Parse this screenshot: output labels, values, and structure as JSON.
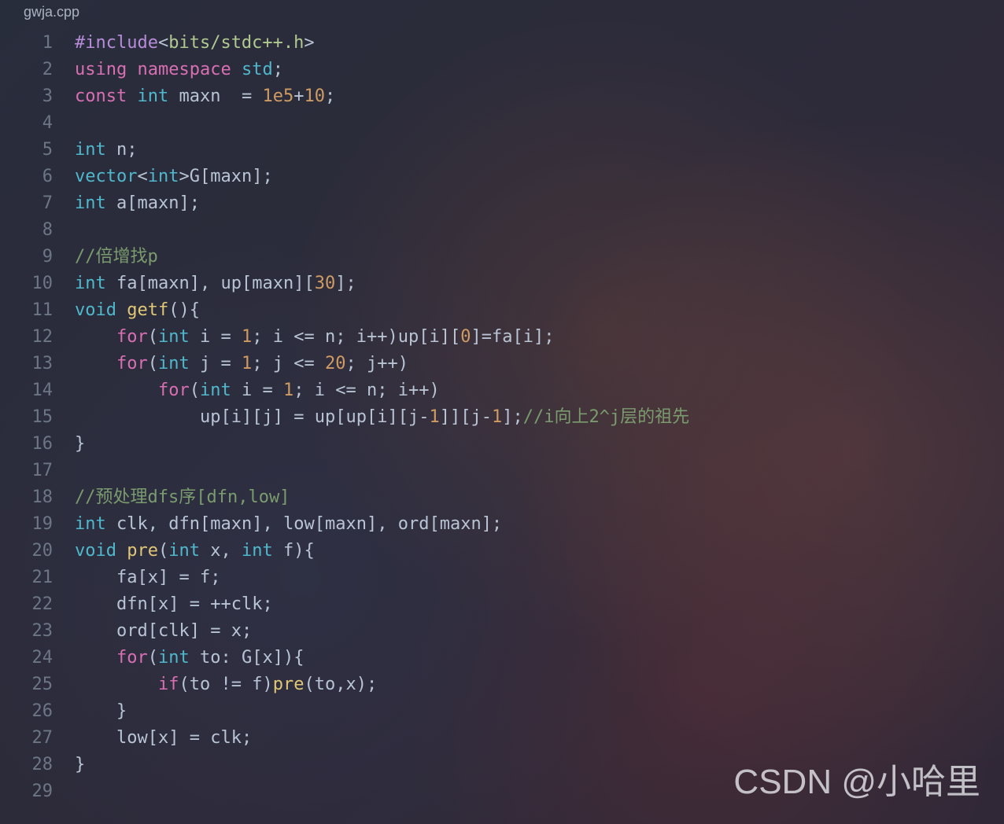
{
  "tab": {
    "filename": "gwja.cpp"
  },
  "watermark": "CSDN @小哈里",
  "lines": [
    {
      "n": 1,
      "tokens": [
        [
          "preproc",
          "#include"
        ],
        [
          "punct",
          "<"
        ],
        [
          "string",
          "bits/stdc++.h"
        ],
        [
          "punct",
          ">"
        ]
      ]
    },
    {
      "n": 2,
      "tokens": [
        [
          "keyword",
          "using"
        ],
        [
          "ident",
          " "
        ],
        [
          "keyword",
          "namespace"
        ],
        [
          "ident",
          " "
        ],
        [
          "type",
          "std"
        ],
        [
          "punct",
          ";"
        ]
      ]
    },
    {
      "n": 3,
      "tokens": [
        [
          "keyword",
          "const"
        ],
        [
          "ident",
          " "
        ],
        [
          "type",
          "int"
        ],
        [
          "ident",
          " maxn  "
        ],
        [
          "op",
          "="
        ],
        [
          "ident",
          " "
        ],
        [
          "number",
          "1e5"
        ],
        [
          "op",
          "+"
        ],
        [
          "number",
          "10"
        ],
        [
          "punct",
          ";"
        ]
      ]
    },
    {
      "n": 4,
      "tokens": []
    },
    {
      "n": 5,
      "tokens": [
        [
          "type",
          "int"
        ],
        [
          "ident",
          " n"
        ],
        [
          "punct",
          ";"
        ]
      ]
    },
    {
      "n": 6,
      "tokens": [
        [
          "type",
          "vector"
        ],
        [
          "punct",
          "<"
        ],
        [
          "type",
          "int"
        ],
        [
          "punct",
          ">"
        ],
        [
          "ident",
          "G"
        ],
        [
          "punct",
          "["
        ],
        [
          "ident",
          "maxn"
        ],
        [
          "punct",
          "];"
        ]
      ]
    },
    {
      "n": 7,
      "tokens": [
        [
          "type",
          "int"
        ],
        [
          "ident",
          " a"
        ],
        [
          "punct",
          "["
        ],
        [
          "ident",
          "maxn"
        ],
        [
          "punct",
          "];"
        ]
      ]
    },
    {
      "n": 8,
      "tokens": []
    },
    {
      "n": 9,
      "tokens": [
        [
          "comment",
          "//倍增找p"
        ]
      ]
    },
    {
      "n": 10,
      "tokens": [
        [
          "type",
          "int"
        ],
        [
          "ident",
          " fa"
        ],
        [
          "punct",
          "["
        ],
        [
          "ident",
          "maxn"
        ],
        [
          "punct",
          "], "
        ],
        [
          "ident",
          "up"
        ],
        [
          "punct",
          "["
        ],
        [
          "ident",
          "maxn"
        ],
        [
          "punct",
          "]["
        ],
        [
          "number",
          "30"
        ],
        [
          "punct",
          "];"
        ]
      ]
    },
    {
      "n": 11,
      "tokens": [
        [
          "type",
          "void"
        ],
        [
          "ident",
          " "
        ],
        [
          "func",
          "getf"
        ],
        [
          "punct",
          "(){"
        ]
      ]
    },
    {
      "n": 12,
      "indent": 1,
      "tokens": [
        [
          "keyword",
          "for"
        ],
        [
          "punct",
          "("
        ],
        [
          "type",
          "int"
        ],
        [
          "ident",
          " i "
        ],
        [
          "op",
          "="
        ],
        [
          "ident",
          " "
        ],
        [
          "number",
          "1"
        ],
        [
          "punct",
          "; "
        ],
        [
          "ident",
          "i "
        ],
        [
          "op",
          "<="
        ],
        [
          "ident",
          " n"
        ],
        [
          "punct",
          "; "
        ],
        [
          "ident",
          "i"
        ],
        [
          "op",
          "++"
        ],
        [
          "punct",
          ")"
        ],
        [
          "ident",
          "up"
        ],
        [
          "punct",
          "["
        ],
        [
          "ident",
          "i"
        ],
        [
          "punct",
          "]["
        ],
        [
          "number",
          "0"
        ],
        [
          "punct",
          "]"
        ],
        [
          "op",
          "="
        ],
        [
          "ident",
          "fa"
        ],
        [
          "punct",
          "["
        ],
        [
          "ident",
          "i"
        ],
        [
          "punct",
          "];"
        ]
      ]
    },
    {
      "n": 13,
      "indent": 1,
      "tokens": [
        [
          "keyword",
          "for"
        ],
        [
          "punct",
          "("
        ],
        [
          "type",
          "int"
        ],
        [
          "ident",
          " j "
        ],
        [
          "op",
          "="
        ],
        [
          "ident",
          " "
        ],
        [
          "number",
          "1"
        ],
        [
          "punct",
          "; "
        ],
        [
          "ident",
          "j "
        ],
        [
          "op",
          "<="
        ],
        [
          "ident",
          " "
        ],
        [
          "number",
          "20"
        ],
        [
          "punct",
          "; "
        ],
        [
          "ident",
          "j"
        ],
        [
          "op",
          "++"
        ],
        [
          "punct",
          ")"
        ]
      ]
    },
    {
      "n": 14,
      "indent": 2,
      "tokens": [
        [
          "keyword",
          "for"
        ],
        [
          "punct",
          "("
        ],
        [
          "type",
          "int"
        ],
        [
          "ident",
          " i "
        ],
        [
          "op",
          "="
        ],
        [
          "ident",
          " "
        ],
        [
          "number",
          "1"
        ],
        [
          "punct",
          "; "
        ],
        [
          "ident",
          "i "
        ],
        [
          "op",
          "<="
        ],
        [
          "ident",
          " n"
        ],
        [
          "punct",
          "; "
        ],
        [
          "ident",
          "i"
        ],
        [
          "op",
          "++"
        ],
        [
          "punct",
          ")"
        ]
      ]
    },
    {
      "n": 15,
      "indent": 3,
      "tokens": [
        [
          "ident",
          "up"
        ],
        [
          "punct",
          "["
        ],
        [
          "ident",
          "i"
        ],
        [
          "punct",
          "]["
        ],
        [
          "ident",
          "j"
        ],
        [
          "punct",
          "] "
        ],
        [
          "op",
          "="
        ],
        [
          "ident",
          " up"
        ],
        [
          "punct",
          "["
        ],
        [
          "ident",
          "up"
        ],
        [
          "punct",
          "["
        ],
        [
          "ident",
          "i"
        ],
        [
          "punct",
          "]["
        ],
        [
          "ident",
          "j"
        ],
        [
          "op",
          "-"
        ],
        [
          "number",
          "1"
        ],
        [
          "punct",
          "]]["
        ],
        [
          "ident",
          "j"
        ],
        [
          "op",
          "-"
        ],
        [
          "number",
          "1"
        ],
        [
          "punct",
          "];"
        ],
        [
          "comment",
          "//i向上2^j层的祖先"
        ]
      ]
    },
    {
      "n": 16,
      "tokens": [
        [
          "punct",
          "}"
        ]
      ]
    },
    {
      "n": 17,
      "tokens": []
    },
    {
      "n": 18,
      "tokens": [
        [
          "comment",
          "//预处理dfs序[dfn,low]"
        ]
      ]
    },
    {
      "n": 19,
      "tokens": [
        [
          "type",
          "int"
        ],
        [
          "ident",
          " clk"
        ],
        [
          "punct",
          ", "
        ],
        [
          "ident",
          "dfn"
        ],
        [
          "punct",
          "["
        ],
        [
          "ident",
          "maxn"
        ],
        [
          "punct",
          "], "
        ],
        [
          "ident",
          "low"
        ],
        [
          "punct",
          "["
        ],
        [
          "ident",
          "maxn"
        ],
        [
          "punct",
          "], "
        ],
        [
          "ident",
          "ord"
        ],
        [
          "punct",
          "["
        ],
        [
          "ident",
          "maxn"
        ],
        [
          "punct",
          "];"
        ]
      ]
    },
    {
      "n": 20,
      "tokens": [
        [
          "type",
          "void"
        ],
        [
          "ident",
          " "
        ],
        [
          "func",
          "pre"
        ],
        [
          "punct",
          "("
        ],
        [
          "type",
          "int"
        ],
        [
          "ident",
          " x"
        ],
        [
          "punct",
          ", "
        ],
        [
          "type",
          "int"
        ],
        [
          "ident",
          " f"
        ],
        [
          "punct",
          "){"
        ]
      ]
    },
    {
      "n": 21,
      "indent": 1,
      "tokens": [
        [
          "ident",
          "fa"
        ],
        [
          "punct",
          "["
        ],
        [
          "ident",
          "x"
        ],
        [
          "punct",
          "] "
        ],
        [
          "op",
          "="
        ],
        [
          "ident",
          " f"
        ],
        [
          "punct",
          ";"
        ]
      ]
    },
    {
      "n": 22,
      "indent": 1,
      "tokens": [
        [
          "ident",
          "dfn"
        ],
        [
          "punct",
          "["
        ],
        [
          "ident",
          "x"
        ],
        [
          "punct",
          "] "
        ],
        [
          "op",
          "="
        ],
        [
          "ident",
          " "
        ],
        [
          "op",
          "++"
        ],
        [
          "ident",
          "clk"
        ],
        [
          "punct",
          ";"
        ]
      ]
    },
    {
      "n": 23,
      "indent": 1,
      "tokens": [
        [
          "ident",
          "ord"
        ],
        [
          "punct",
          "["
        ],
        [
          "ident",
          "clk"
        ],
        [
          "punct",
          "] "
        ],
        [
          "op",
          "="
        ],
        [
          "ident",
          " x"
        ],
        [
          "punct",
          ";"
        ]
      ]
    },
    {
      "n": 24,
      "indent": 1,
      "tokens": [
        [
          "keyword",
          "for"
        ],
        [
          "punct",
          "("
        ],
        [
          "type",
          "int"
        ],
        [
          "ident",
          " to"
        ],
        [
          "punct",
          ": "
        ],
        [
          "ident",
          "G"
        ],
        [
          "punct",
          "["
        ],
        [
          "ident",
          "x"
        ],
        [
          "punct",
          "]){"
        ]
      ]
    },
    {
      "n": 25,
      "indent": 2,
      "tokens": [
        [
          "keyword",
          "if"
        ],
        [
          "punct",
          "("
        ],
        [
          "ident",
          "to "
        ],
        [
          "op",
          "!="
        ],
        [
          "ident",
          " f"
        ],
        [
          "punct",
          ")"
        ],
        [
          "func",
          "pre"
        ],
        [
          "punct",
          "("
        ],
        [
          "ident",
          "to"
        ],
        [
          "punct",
          ","
        ],
        [
          "ident",
          "x"
        ],
        [
          "punct",
          ");"
        ]
      ]
    },
    {
      "n": 26,
      "indent": 1,
      "tokens": [
        [
          "punct",
          "}"
        ]
      ]
    },
    {
      "n": 27,
      "indent": 1,
      "tokens": [
        [
          "ident",
          "low"
        ],
        [
          "punct",
          "["
        ],
        [
          "ident",
          "x"
        ],
        [
          "punct",
          "] "
        ],
        [
          "op",
          "="
        ],
        [
          "ident",
          " clk"
        ],
        [
          "punct",
          ";"
        ]
      ]
    },
    {
      "n": 28,
      "tokens": [
        [
          "punct",
          "}"
        ]
      ]
    },
    {
      "n": 29,
      "tokens": []
    }
  ]
}
